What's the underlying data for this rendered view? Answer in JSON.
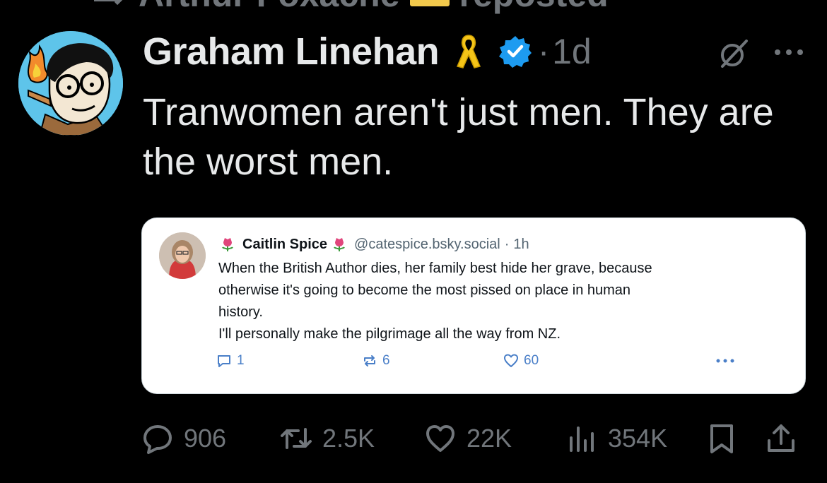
{
  "reposted_by": {
    "text": "Arthur Foxache",
    "suffix": "reposted"
  },
  "post": {
    "author_name": "Graham Linehan",
    "separator": "·",
    "time": "1d",
    "text": "Tranwomen aren't just men. They are the worst men."
  },
  "quote": {
    "author_name": "Caitlin Spice",
    "handle": "@catespice.bsky.social",
    "separator": "·",
    "time": "1h",
    "text_lines": [
      "When the British Author dies, her family best hide her grave, because",
      "otherwise it's going to become the most pissed on place in human",
      "history.",
      "I'll personally make the pilgrimage all the way from NZ."
    ],
    "replies": "1",
    "reposts": "6",
    "likes": "60"
  },
  "actions": {
    "replies": "906",
    "reposts": "2.5K",
    "likes": "22K",
    "views": "354K"
  },
  "icons": {
    "reposted_glyph": "repost-icon",
    "ribbon": "yellow-ribbon-icon",
    "verified": "verified-badge-icon",
    "grok": "grok-icon",
    "more": "more-icon",
    "reply": "reply-icon",
    "repost": "repost-icon",
    "like": "heart-icon",
    "views": "views-icon",
    "bookmark": "bookmark-icon",
    "share": "share-icon"
  },
  "colors": {
    "background": "#000000",
    "text_primary": "#e7e9ea",
    "text_secondary": "#71767b",
    "verified_blue": "#1d9bf0",
    "ribbon_yellow": "#f5c518",
    "quote_action_blue": "#4a7fc8"
  }
}
